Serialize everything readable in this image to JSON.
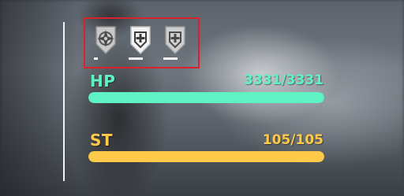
{
  "hud": {
    "buffs": [
      {
        "icon": "compass-star-shield-icon",
        "remaining": 0.15
      },
      {
        "icon": "plus-shield-icon",
        "remaining": 0.6
      },
      {
        "icon": "plus-shield-dim-icon",
        "remaining": 0.6
      }
    ],
    "hp": {
      "label": "HP",
      "value_text": "3331/3331",
      "current": 3331,
      "max": 3331,
      "color": "#5ff2c2"
    },
    "st": {
      "label": "ST",
      "value_text": "105/105",
      "current": 105,
      "max": 105,
      "color": "#ffc94a"
    },
    "highlight_color": "#d9232c"
  }
}
